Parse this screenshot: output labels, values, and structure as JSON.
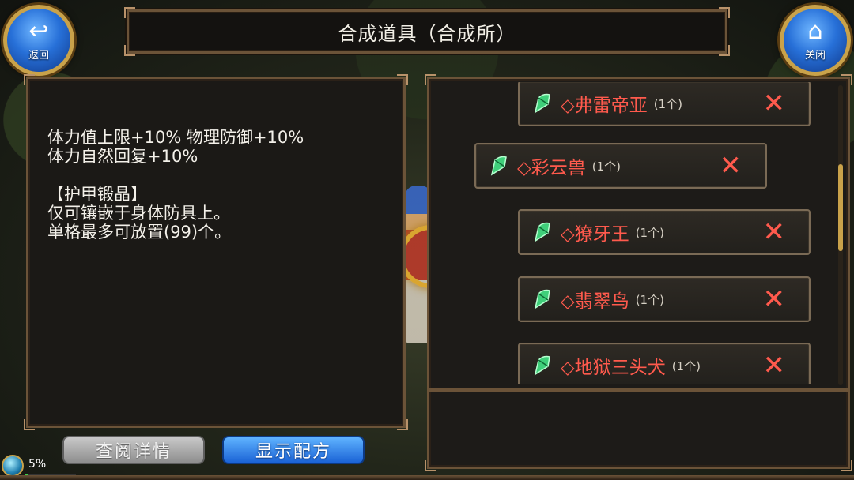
{
  "title": "合成道具（合成所）",
  "nav": {
    "back_label": "返回",
    "close_label": "关闭"
  },
  "description": {
    "lines": "体力值上限+10% 物理防御+10%\n体力自然回复+10%\n\n【护甲锻晶】\n仅可镶嵌于身体防具上。\n单格最多可放置(99)个。"
  },
  "materials": [
    {
      "name": "◇弗雷帝亚",
      "qty": "(1个)"
    },
    {
      "name": "◇彩云兽",
      "qty": "(1个)"
    },
    {
      "name": "◇獠牙王",
      "qty": "(1个)"
    },
    {
      "name": "◇翡翠鸟",
      "qty": "(1个)"
    },
    {
      "name": "◇地狱三头犬",
      "qty": "(1个)"
    }
  ],
  "buttons": {
    "detail_label": "查阅详情",
    "recipe_label": "显示配方"
  },
  "status": {
    "percent_text": "5%",
    "progress": 0.05
  },
  "colors": {
    "item_name": "#ff5a4d",
    "accent_gold": "#c9a24a",
    "button_blue": "#1b63d6"
  },
  "icons": {
    "back": "return-arrow-icon",
    "close": "home-icon",
    "item": "green-gem-icon",
    "remove": "x-icon"
  }
}
